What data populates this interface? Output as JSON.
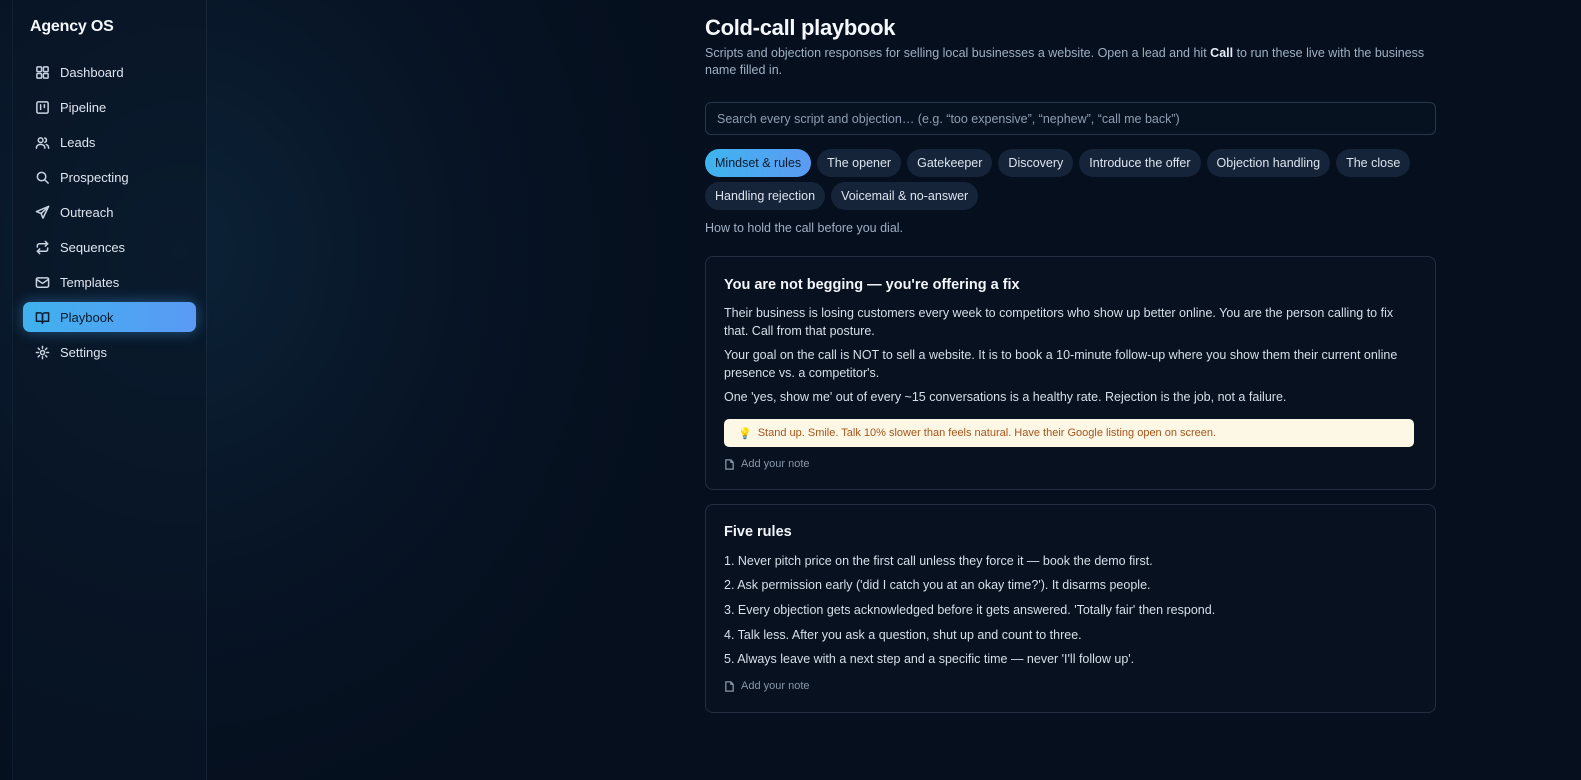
{
  "app": {
    "brand": "Agency OS"
  },
  "sidebar": {
    "items": [
      {
        "label": "Dashboard",
        "icon": "dashboard-icon"
      },
      {
        "label": "Pipeline",
        "icon": "pipeline-icon"
      },
      {
        "label": "Leads",
        "icon": "users-icon"
      },
      {
        "label": "Prospecting",
        "icon": "search-icon"
      },
      {
        "label": "Outreach",
        "icon": "send-icon"
      },
      {
        "label": "Sequences",
        "icon": "repeat-icon"
      },
      {
        "label": "Templates",
        "icon": "mail-icon"
      },
      {
        "label": "Playbook",
        "icon": "book-icon",
        "active": true
      },
      {
        "label": "Settings",
        "icon": "gear-icon"
      }
    ]
  },
  "page": {
    "title": "Cold-call playbook",
    "subtitle_before": "Scripts and objection responses for selling local businesses a website. Open a lead and hit ",
    "subtitle_bold": "Call",
    "subtitle_after": " to run these live with the business name filled in.",
    "search_placeholder": "Search every script and objection… (e.g. “too expensive”, “nephew”, “call me back”)",
    "tabs": [
      {
        "label": "Mindset & rules",
        "active": true
      },
      {
        "label": "The opener"
      },
      {
        "label": "Gatekeeper"
      },
      {
        "label": "Discovery"
      },
      {
        "label": "Introduce the offer"
      },
      {
        "label": "Objection handling"
      },
      {
        "label": "The close"
      },
      {
        "label": "Handling rejection"
      },
      {
        "label": "Voicemail & no-answer"
      }
    ],
    "section_desc": "How to hold the call before you dial."
  },
  "cards": {
    "card1": {
      "title": "You are not begging — you're offering a fix",
      "p1": "Their business is losing customers every week to competitors who show up better online. You are the person calling to fix that. Call from that posture.",
      "p2": "Your goal on the call is NOT to sell a website. It is to book a 10-minute follow-up where you show them their current online presence vs. a competitor's.",
      "p3": "One 'yes, show me' out of every ~15 conversations is a healthy rate. Rejection is the job, not a failure.",
      "tip": "Stand up. Smile. Talk 10% slower than feels natural. Have their Google listing open on screen.",
      "note": "Add your note"
    },
    "card2": {
      "title": "Five rules",
      "rules": [
        "1. Never pitch price on the first call unless they force it — book the demo first.",
        "2. Ask permission early ('did I catch you at an okay time?'). It disarms people.",
        "3. Every objection gets acknowledged before it gets answered. 'Totally fair' then respond.",
        "4. Talk less. After you ask a question, shut up and count to three.",
        "5. Always leave with a next step and a specific time — never 'I'll follow up'."
      ],
      "note": "Add your note"
    }
  },
  "colors": {
    "accent": "#4aa8f0",
    "tip_bg": "#fdf7e6",
    "tip_text": "#a5551b"
  }
}
